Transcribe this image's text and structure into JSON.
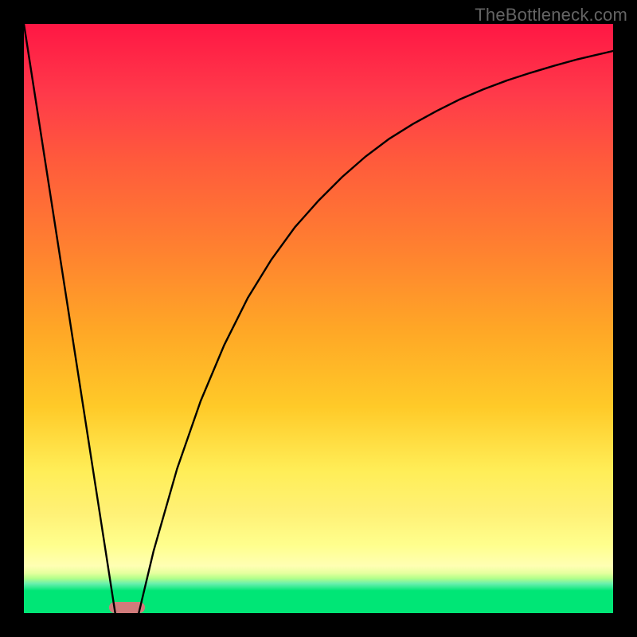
{
  "watermark": "TheBottleneck.com",
  "chart_data": {
    "type": "line",
    "title": "",
    "xlabel": "",
    "ylabel": "",
    "xlim": [
      0,
      1
    ],
    "ylim": [
      0,
      1
    ],
    "grid": false,
    "legend": false,
    "notes": "Bottleneck-style curve: y≈1 represents maximum bottleneck (red), y≈0 is optimal (green). Piecewise: steep linear descent from x=0,y=1 to x≈0.155,y=0; then asymptotic rise toward y≈0.96 as x→1. Background is a vertical red→green gradient; a small rounded marker sits at the minimum.",
    "background_gradient_stops": [
      {
        "pos": 0.0,
        "color": "#ff1744"
      },
      {
        "pos": 0.12,
        "color": "#ff3a4a"
      },
      {
        "pos": 0.23,
        "color": "#ff5a3c"
      },
      {
        "pos": 0.38,
        "color": "#ff8030"
      },
      {
        "pos": 0.52,
        "color": "#ffa726"
      },
      {
        "pos": 0.65,
        "color": "#ffca28"
      },
      {
        "pos": 0.76,
        "color": "#ffee58"
      },
      {
        "pos": 0.83,
        "color": "#fff176"
      },
      {
        "pos": 0.885,
        "color": "#ffff8d"
      },
      {
        "pos": 0.92,
        "color": "#ffffb3"
      },
      {
        "pos": 0.932,
        "color": "#e6ff9e"
      },
      {
        "pos": 0.941,
        "color": "#b2ff8a"
      },
      {
        "pos": 0.95,
        "color": "#69f0ae"
      },
      {
        "pos": 0.962,
        "color": "#00e676"
      },
      {
        "pos": 1.0,
        "color": "#00e676"
      }
    ],
    "series": [
      {
        "name": "left-descent",
        "x": [
          0.0,
          0.02,
          0.04,
          0.06,
          0.08,
          0.1,
          0.12,
          0.14,
          0.155
        ],
        "y": [
          1.0,
          0.871,
          0.742,
          0.613,
          0.484,
          0.355,
          0.226,
          0.097,
          0.0
        ]
      },
      {
        "name": "right-ascent",
        "x": [
          0.195,
          0.22,
          0.26,
          0.3,
          0.34,
          0.38,
          0.42,
          0.46,
          0.5,
          0.54,
          0.58,
          0.62,
          0.66,
          0.7,
          0.74,
          0.78,
          0.82,
          0.86,
          0.9,
          0.94,
          0.97,
          1.0
        ],
        "y": [
          0.0,
          0.105,
          0.245,
          0.36,
          0.455,
          0.535,
          0.6,
          0.655,
          0.7,
          0.74,
          0.775,
          0.805,
          0.83,
          0.852,
          0.872,
          0.889,
          0.904,
          0.917,
          0.929,
          0.94,
          0.947,
          0.954
        ]
      }
    ],
    "optimum_marker": {
      "x_center": 0.175,
      "width_frac": 0.06,
      "color": "#d17b7b"
    }
  }
}
